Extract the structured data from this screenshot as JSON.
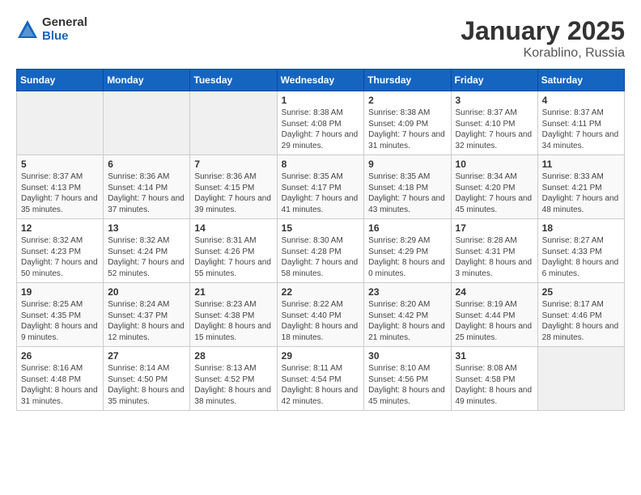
{
  "logo": {
    "general": "General",
    "blue": "Blue"
  },
  "title": "January 2025",
  "location": "Korablino, Russia",
  "days_header": [
    "Sunday",
    "Monday",
    "Tuesday",
    "Wednesday",
    "Thursday",
    "Friday",
    "Saturday"
  ],
  "weeks": [
    [
      {
        "day": "",
        "sunrise": "",
        "sunset": "",
        "daylight": ""
      },
      {
        "day": "",
        "sunrise": "",
        "sunset": "",
        "daylight": ""
      },
      {
        "day": "",
        "sunrise": "",
        "sunset": "",
        "daylight": ""
      },
      {
        "day": "1",
        "sunrise": "Sunrise: 8:38 AM",
        "sunset": "Sunset: 4:08 PM",
        "daylight": "Daylight: 7 hours and 29 minutes."
      },
      {
        "day": "2",
        "sunrise": "Sunrise: 8:38 AM",
        "sunset": "Sunset: 4:09 PM",
        "daylight": "Daylight: 7 hours and 31 minutes."
      },
      {
        "day": "3",
        "sunrise": "Sunrise: 8:37 AM",
        "sunset": "Sunset: 4:10 PM",
        "daylight": "Daylight: 7 hours and 32 minutes."
      },
      {
        "day": "4",
        "sunrise": "Sunrise: 8:37 AM",
        "sunset": "Sunset: 4:11 PM",
        "daylight": "Daylight: 7 hours and 34 minutes."
      }
    ],
    [
      {
        "day": "5",
        "sunrise": "Sunrise: 8:37 AM",
        "sunset": "Sunset: 4:13 PM",
        "daylight": "Daylight: 7 hours and 35 minutes."
      },
      {
        "day": "6",
        "sunrise": "Sunrise: 8:36 AM",
        "sunset": "Sunset: 4:14 PM",
        "daylight": "Daylight: 7 hours and 37 minutes."
      },
      {
        "day": "7",
        "sunrise": "Sunrise: 8:36 AM",
        "sunset": "Sunset: 4:15 PM",
        "daylight": "Daylight: 7 hours and 39 minutes."
      },
      {
        "day": "8",
        "sunrise": "Sunrise: 8:35 AM",
        "sunset": "Sunset: 4:17 PM",
        "daylight": "Daylight: 7 hours and 41 minutes."
      },
      {
        "day": "9",
        "sunrise": "Sunrise: 8:35 AM",
        "sunset": "Sunset: 4:18 PM",
        "daylight": "Daylight: 7 hours and 43 minutes."
      },
      {
        "day": "10",
        "sunrise": "Sunrise: 8:34 AM",
        "sunset": "Sunset: 4:20 PM",
        "daylight": "Daylight: 7 hours and 45 minutes."
      },
      {
        "day": "11",
        "sunrise": "Sunrise: 8:33 AM",
        "sunset": "Sunset: 4:21 PM",
        "daylight": "Daylight: 7 hours and 48 minutes."
      }
    ],
    [
      {
        "day": "12",
        "sunrise": "Sunrise: 8:32 AM",
        "sunset": "Sunset: 4:23 PM",
        "daylight": "Daylight: 7 hours and 50 minutes."
      },
      {
        "day": "13",
        "sunrise": "Sunrise: 8:32 AM",
        "sunset": "Sunset: 4:24 PM",
        "daylight": "Daylight: 7 hours and 52 minutes."
      },
      {
        "day": "14",
        "sunrise": "Sunrise: 8:31 AM",
        "sunset": "Sunset: 4:26 PM",
        "daylight": "Daylight: 7 hours and 55 minutes."
      },
      {
        "day": "15",
        "sunrise": "Sunrise: 8:30 AM",
        "sunset": "Sunset: 4:28 PM",
        "daylight": "Daylight: 7 hours and 58 minutes."
      },
      {
        "day": "16",
        "sunrise": "Sunrise: 8:29 AM",
        "sunset": "Sunset: 4:29 PM",
        "daylight": "Daylight: 8 hours and 0 minutes."
      },
      {
        "day": "17",
        "sunrise": "Sunrise: 8:28 AM",
        "sunset": "Sunset: 4:31 PM",
        "daylight": "Daylight: 8 hours and 3 minutes."
      },
      {
        "day": "18",
        "sunrise": "Sunrise: 8:27 AM",
        "sunset": "Sunset: 4:33 PM",
        "daylight": "Daylight: 8 hours and 6 minutes."
      }
    ],
    [
      {
        "day": "19",
        "sunrise": "Sunrise: 8:25 AM",
        "sunset": "Sunset: 4:35 PM",
        "daylight": "Daylight: 8 hours and 9 minutes."
      },
      {
        "day": "20",
        "sunrise": "Sunrise: 8:24 AM",
        "sunset": "Sunset: 4:37 PM",
        "daylight": "Daylight: 8 hours and 12 minutes."
      },
      {
        "day": "21",
        "sunrise": "Sunrise: 8:23 AM",
        "sunset": "Sunset: 4:38 PM",
        "daylight": "Daylight: 8 hours and 15 minutes."
      },
      {
        "day": "22",
        "sunrise": "Sunrise: 8:22 AM",
        "sunset": "Sunset: 4:40 PM",
        "daylight": "Daylight: 8 hours and 18 minutes."
      },
      {
        "day": "23",
        "sunrise": "Sunrise: 8:20 AM",
        "sunset": "Sunset: 4:42 PM",
        "daylight": "Daylight: 8 hours and 21 minutes."
      },
      {
        "day": "24",
        "sunrise": "Sunrise: 8:19 AM",
        "sunset": "Sunset: 4:44 PM",
        "daylight": "Daylight: 8 hours and 25 minutes."
      },
      {
        "day": "25",
        "sunrise": "Sunrise: 8:17 AM",
        "sunset": "Sunset: 4:46 PM",
        "daylight": "Daylight: 8 hours and 28 minutes."
      }
    ],
    [
      {
        "day": "26",
        "sunrise": "Sunrise: 8:16 AM",
        "sunset": "Sunset: 4:48 PM",
        "daylight": "Daylight: 8 hours and 31 minutes."
      },
      {
        "day": "27",
        "sunrise": "Sunrise: 8:14 AM",
        "sunset": "Sunset: 4:50 PM",
        "daylight": "Daylight: 8 hours and 35 minutes."
      },
      {
        "day": "28",
        "sunrise": "Sunrise: 8:13 AM",
        "sunset": "Sunset: 4:52 PM",
        "daylight": "Daylight: 8 hours and 38 minutes."
      },
      {
        "day": "29",
        "sunrise": "Sunrise: 8:11 AM",
        "sunset": "Sunset: 4:54 PM",
        "daylight": "Daylight: 8 hours and 42 minutes."
      },
      {
        "day": "30",
        "sunrise": "Sunrise: 8:10 AM",
        "sunset": "Sunset: 4:56 PM",
        "daylight": "Daylight: 8 hours and 45 minutes."
      },
      {
        "day": "31",
        "sunrise": "Sunrise: 8:08 AM",
        "sunset": "Sunset: 4:58 PM",
        "daylight": "Daylight: 8 hours and 49 minutes."
      },
      {
        "day": "",
        "sunrise": "",
        "sunset": "",
        "daylight": ""
      }
    ]
  ]
}
